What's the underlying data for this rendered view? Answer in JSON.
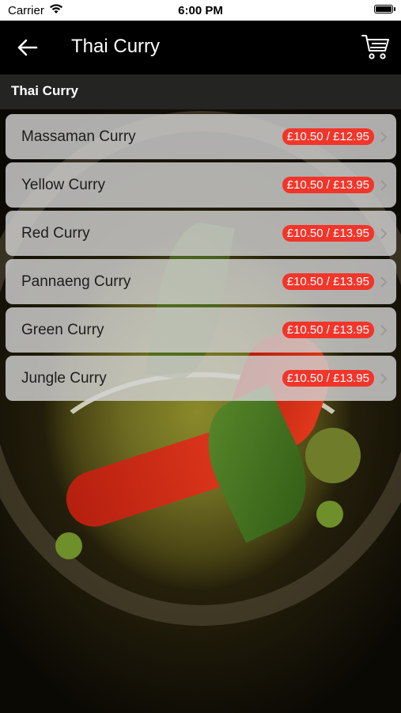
{
  "status_bar": {
    "carrier": "Carrier",
    "time": "6:00 PM"
  },
  "nav": {
    "title": "Thai Curry",
    "back_icon": "arrow-left-icon",
    "cart_icon": "cart-icon"
  },
  "section": {
    "label": "Thai Curry"
  },
  "items": [
    {
      "name": "Massaman Curry",
      "price": "£10.50 / £12.95"
    },
    {
      "name": "Yellow Curry",
      "price": "£10.50 / £13.95"
    },
    {
      "name": "Red Curry",
      "price": "£10.50 / £13.95"
    },
    {
      "name": "Pannaeng Curry",
      "price": "£10.50 / £13.95"
    },
    {
      "name": "Green Curry",
      "price": "£10.50 / £13.95"
    },
    {
      "name": "Jungle Curry",
      "price": "£10.50 / £13.95"
    }
  ],
  "colors": {
    "price_badge": "#f2352a",
    "nav_background": "#000000"
  }
}
